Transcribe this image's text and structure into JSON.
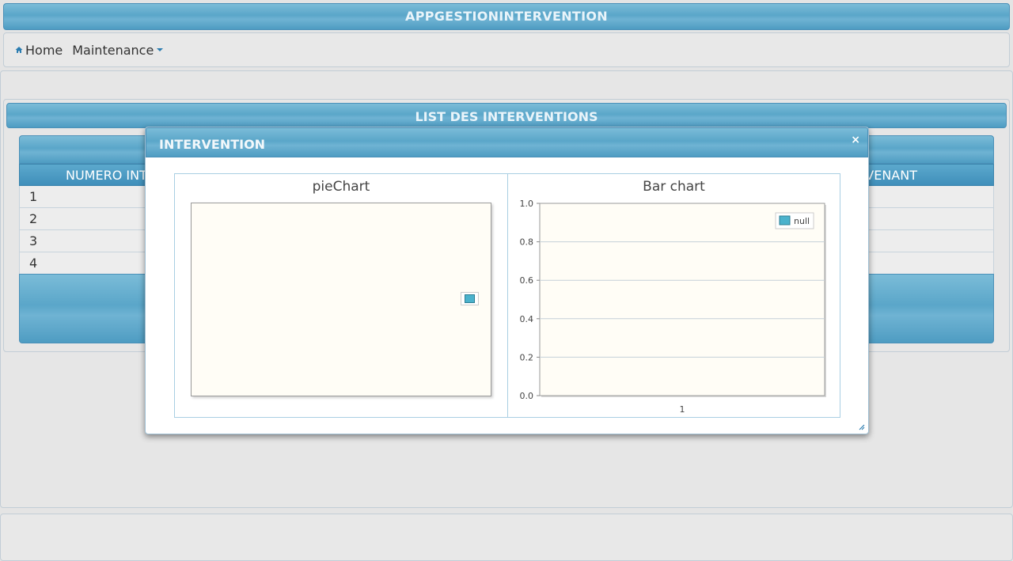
{
  "app": {
    "title": "APPGESTIONINTERVENTION"
  },
  "menu": {
    "home_label": "Home",
    "maintenance_label": "Maintenance"
  },
  "list": {
    "title": "LIST DES INTERVENTIONS",
    "col_left": "NUMERO INT",
    "col_right": "VENANT",
    "rows": [
      "1",
      "2",
      "3",
      "4"
    ]
  },
  "dialog": {
    "title": "INTERVENTION",
    "close_symbol": "×",
    "pie_title": "pieChart",
    "bar_title": "Bar chart"
  },
  "colors": {
    "accent": "#5aa6c9",
    "series": "#4bb2cc"
  },
  "chart_data": [
    {
      "type": "pie",
      "title": "pieChart",
      "series": [
        {
          "name": "",
          "values": []
        }
      ],
      "legend": "right"
    },
    {
      "type": "bar",
      "title": "Bar chart",
      "categories": [
        "1"
      ],
      "series": [
        {
          "name": "null",
          "values": []
        }
      ],
      "ylim": [
        0,
        1.0
      ],
      "yticks": [
        "0.0",
        "0.2",
        "0.4",
        "0.6",
        "0.8",
        "1.0"
      ],
      "grid": true,
      "legend": "top-right"
    }
  ]
}
